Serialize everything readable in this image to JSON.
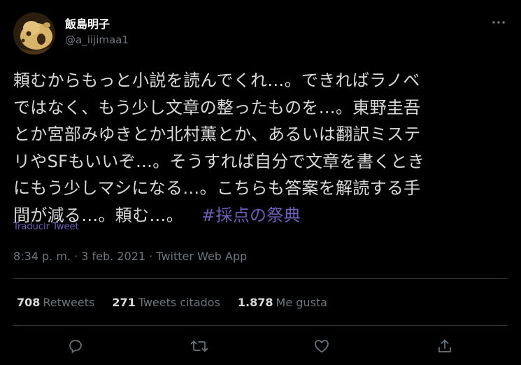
{
  "author": {
    "display_name": "飯島明子",
    "handle": "@a_iijimaa1"
  },
  "tweet": {
    "lines": [
      "頼むからもっと小説を読んでくれ…。できればラノベ",
      "ではなく、もう少し文章の整ったものを…。東野圭吾",
      "とか宮部みゆきとか北村薫とか、あるいは翻訳ミステ",
      "リやSFもいいぞ…。そうすれば自分で文章を書くとき",
      "にもう少しマシになる…。こちらも答案を解読する手",
      "間が減る…。頼む…。"
    ],
    "hashtag": "#採点の祭典",
    "translate_label": "Traducir Tweet"
  },
  "meta": {
    "time": "8:34 p. m.",
    "separator_1": " · ",
    "date": "3 feb. 2021",
    "separator_2": " · ",
    "source": "Twitter Web App"
  },
  "stats": {
    "retweets_count": "708",
    "retweets_label": "Retweets",
    "quotes_count": "271",
    "quotes_label": "Tweets citados",
    "likes_count": "1.878",
    "likes_label": "Me gusta"
  },
  "colors": {
    "background": "#000000",
    "text": "#d9d9d9",
    "muted": "#6e767d",
    "link": "#6f5fb8",
    "divider": "#2f3336"
  },
  "icons": {
    "more": "more-horizontal-icon",
    "reply": "reply-icon",
    "retweet": "retweet-icon",
    "like": "heart-icon",
    "share": "share-icon"
  }
}
